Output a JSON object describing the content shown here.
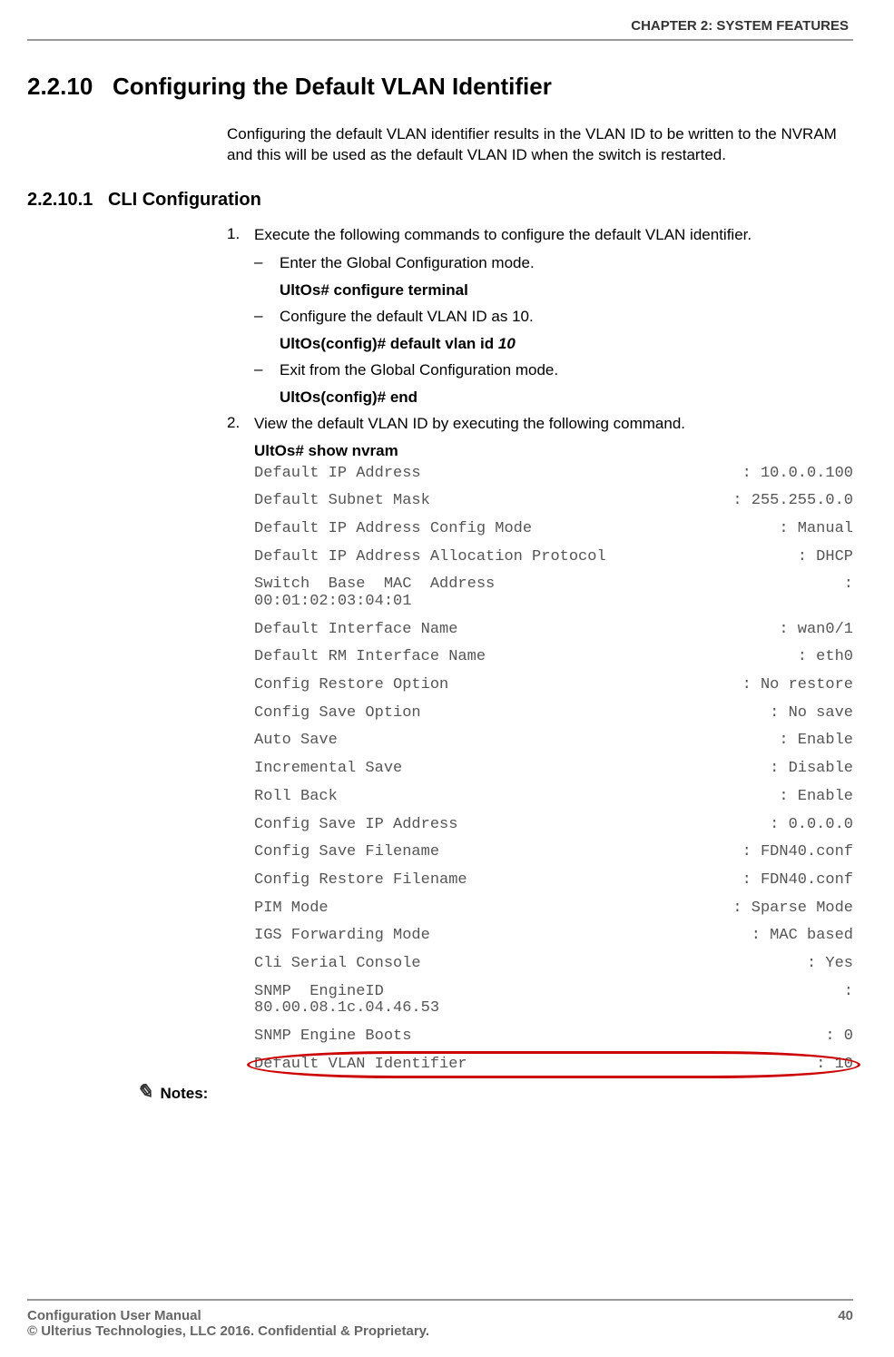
{
  "chapter": "CHAPTER 2: SYSTEM FEATURES",
  "section": {
    "number": "2.2.10",
    "title": "Configuring the Default VLAN Identifier",
    "intro": "Configuring the default VLAN identifier results in the VLAN ID to be written to the NVRAM and this will be used as the default VLAN ID when the switch is restarted."
  },
  "subsection": {
    "number": "2.2.10.1",
    "title": "CLI Configuration"
  },
  "step1": {
    "num": "1.",
    "text": "Execute the following commands to configure the default VLAN identifier.",
    "a_text": "Enter the Global Configuration mode.",
    "a_cmd": "UltOs# configure terminal",
    "b_text": "Configure the default VLAN ID as 10.",
    "b_cmd_prefix": "UltOs(config)# default vlan id ",
    "b_cmd_arg": "10",
    "c_text": "Exit from the Global Configuration mode.",
    "c_cmd": "UltOs(config)# end"
  },
  "step2": {
    "num": "2.",
    "text": "View the default VLAN ID by executing the following command.",
    "cmd": "UltOs# show nvram"
  },
  "nvram": {
    "r1": {
      "label": "Default IP Address",
      "value": ": 10.0.0.100"
    },
    "r2": {
      "label": "Default Subnet Mask",
      "value": ": 255.255.0.0"
    },
    "r3": {
      "label": "Default IP Address Config Mode",
      "value": ": Manual"
    },
    "r4": {
      "label": "Default IP Address Allocation Protocol",
      "value": ": DHCP"
    },
    "r5": {
      "top": "Switch  Base  MAC  Address",
      "colon": ":",
      "bottom": "00:01:02:03:04:01"
    },
    "r6": {
      "label": "Default Interface Name",
      "value": ": wan0/1"
    },
    "r7": {
      "label": "Default RM Interface Name",
      "value": ": eth0"
    },
    "r8": {
      "label": "Config Restore Option",
      "value": ": No restore"
    },
    "r9": {
      "label": "Config Save Option",
      "value": ": No save"
    },
    "r10": {
      "label": "Auto Save",
      "value": ": Enable"
    },
    "r11": {
      "label": "Incremental Save",
      "value": ": Disable"
    },
    "r12": {
      "label": "Roll Back",
      "value": ": Enable"
    },
    "r13": {
      "label": "Config Save IP Address",
      "value": ": 0.0.0.0"
    },
    "r14": {
      "label": "Config Save Filename",
      "value": ": FDN40.conf"
    },
    "r15": {
      "label": "Config Restore Filename",
      "value": ": FDN40.conf"
    },
    "r16": {
      "label": "PIM Mode",
      "value": ": Sparse Mode"
    },
    "r17": {
      "label": "IGS Forwarding Mode",
      "value": ": MAC based"
    },
    "r18": {
      "label": "Cli Serial Console",
      "value": ": Yes"
    },
    "r19": {
      "top": "SNMP  EngineID",
      "colon": ":",
      "bottom": "80.00.08.1c.04.46.53"
    },
    "r20": {
      "label": "SNMP Engine Boots",
      "value": ": 0"
    },
    "r21": {
      "label": "Default VLAN Identifier",
      "value": ": 10"
    }
  },
  "notes_label": "Notes:",
  "footer": {
    "left1": "Configuration User Manual",
    "right1": "40",
    "line2": "© Ulterius Technologies, LLC 2016. Confidential & Proprietary."
  }
}
